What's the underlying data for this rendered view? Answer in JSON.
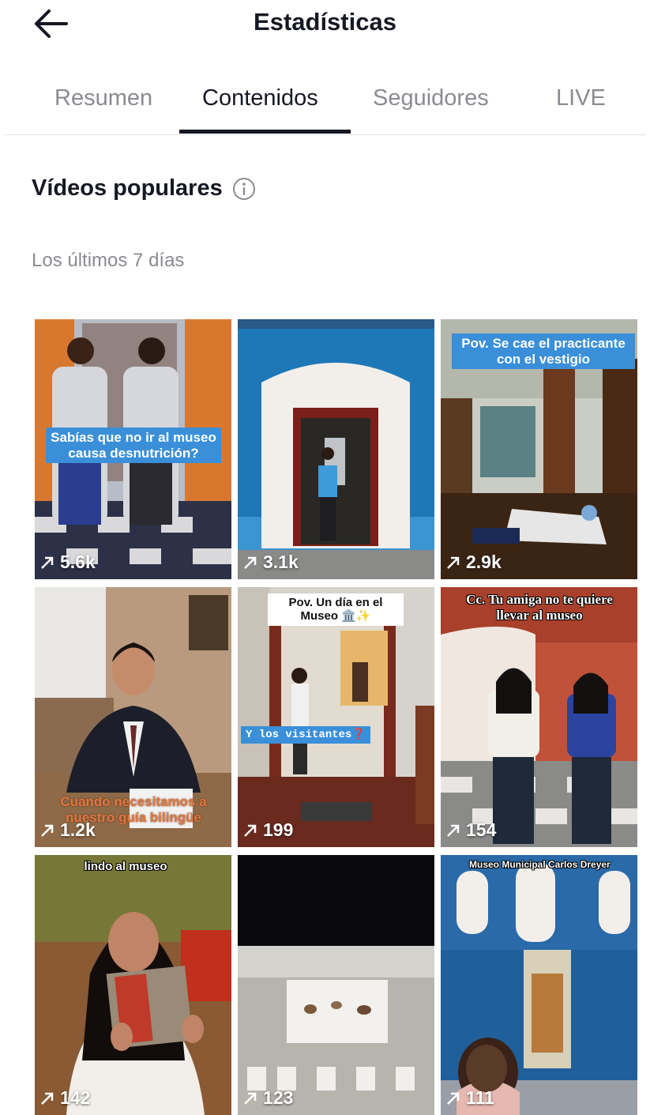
{
  "header": {
    "title": "Estadísticas"
  },
  "tabs": [
    {
      "label": "Resumen",
      "active": false
    },
    {
      "label": "Contenidos",
      "active": true
    },
    {
      "label": "Seguidores",
      "active": false
    },
    {
      "label": "LIVE",
      "active": false
    }
  ],
  "section": {
    "title": "Vídeos populares",
    "period": "Los últimos 7 días"
  },
  "videos": [
    {
      "views": "5.6k",
      "caption": "Sabías que no ir al museo causa desnutrición?"
    },
    {
      "views": "3.1k",
      "caption": ""
    },
    {
      "views": "2.9k",
      "caption": "Pov. Se cae el practicante con el vestigio"
    },
    {
      "views": "1.2k",
      "caption": "Cuando necesitamos a nuestro guía bilingüe"
    },
    {
      "views": "199",
      "caption": "Pov. Un día en el Museo 🏛️✨",
      "caption2": "Y los visitantes❓"
    },
    {
      "views": "154",
      "caption": "Cc. Tu amiga no te quiere llevar al museo"
    },
    {
      "views": "142",
      "caption": "lindo al museo"
    },
    {
      "views": "123",
      "caption": ""
    },
    {
      "views": "111",
      "caption": "Museo Municipal Carlos Dreyer"
    }
  ],
  "colors": {
    "text": "#161823",
    "muted": "#8a8b91",
    "divider": "#e3e3e4",
    "caption_blue": "#3a8fd8"
  }
}
